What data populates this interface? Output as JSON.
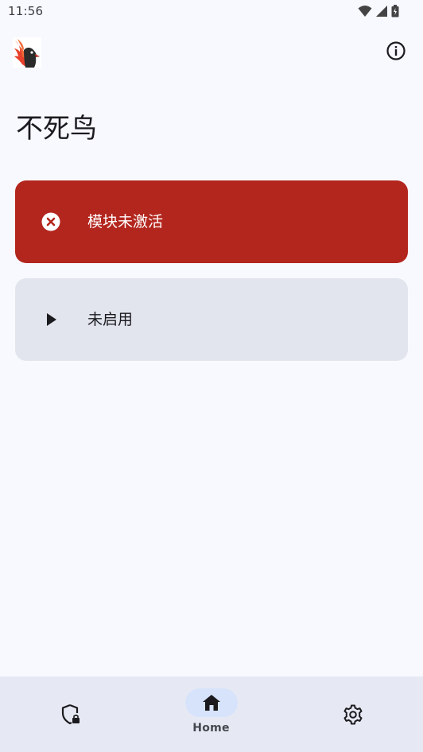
{
  "status_bar": {
    "time": "11:56",
    "icons": [
      "wifi-icon",
      "signal-icon",
      "battery-icon"
    ]
  },
  "app_bar": {
    "logo": "phoenix-logo",
    "info_icon": "info-icon"
  },
  "page": {
    "title": "不死鸟"
  },
  "cards": {
    "module_status": {
      "icon": "error-circle-icon",
      "label": "模块未激活",
      "color": "#b3261e"
    },
    "enable": {
      "icon": "play-icon",
      "label": "未启用",
      "color": "#e2e5ee"
    }
  },
  "bottom_nav": {
    "items": [
      {
        "icon": "shield-lock-icon",
        "label": ""
      },
      {
        "icon": "home-icon",
        "label": "Home",
        "selected": true
      },
      {
        "icon": "gear-icon",
        "label": ""
      }
    ]
  },
  "colors": {
    "background": "#f8f9ff",
    "accent_pill": "#d6e3fb",
    "nav_background": "#e6e9f3"
  }
}
